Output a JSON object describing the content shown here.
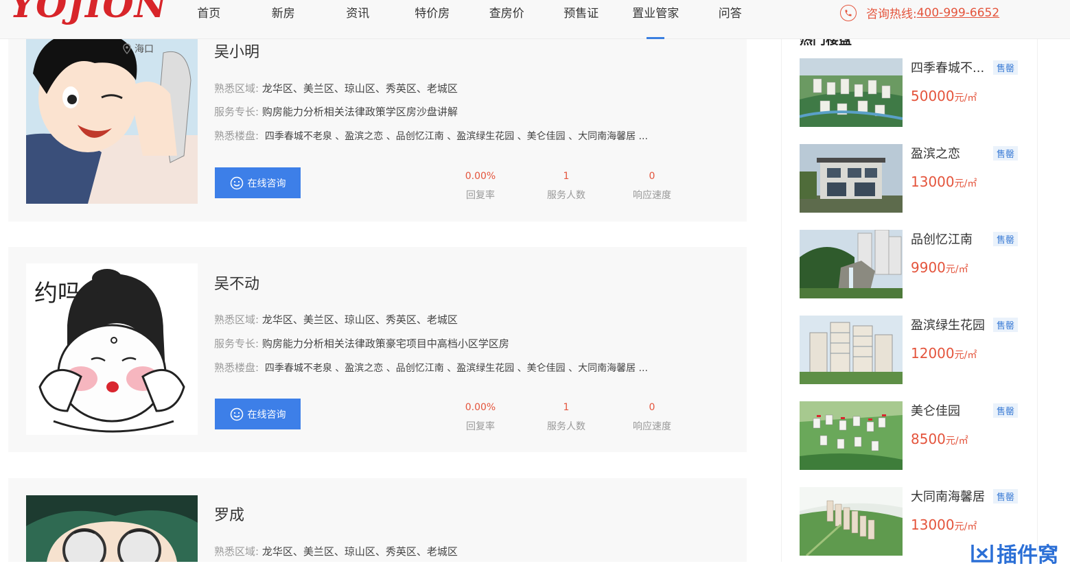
{
  "header": {
    "logo": "YOJION",
    "nav": [
      "首页",
      "新房",
      "资讯",
      "特价房",
      "查房价",
      "预售证",
      "置业管家",
      "问答"
    ],
    "active_nav_index": 6,
    "hotline_label": "咨询热线:",
    "hotline_number": "400-999-6652"
  },
  "agents": [
    {
      "name": "吴小明",
      "location": "海口",
      "areas_label": "熟悉区域:",
      "areas": "龙华区、美兰区、琼山区、秀英区、老城区",
      "specialty_label": "服务专长:",
      "specialty": "购房能力分析相关法律政策学区房沙盘讲解",
      "properties_label": "熟悉楼盘:",
      "properties": "四季春城不老泉 、盈滨之恋 、品创忆江南 、盈滨绿生花园 、美仑佳园 、大同南海馨居 ...",
      "consult_label": "在线咨询",
      "stats": [
        {
          "value": "0.00%",
          "label": "回复率"
        },
        {
          "value": "1",
          "label": "服务人数"
        },
        {
          "value": "0",
          "label": "响应速度"
        }
      ]
    },
    {
      "name": "吴不动",
      "areas_label": "熟悉区域:",
      "areas": "龙华区、美兰区、琼山区、秀英区、老城区",
      "specialty_label": "服务专长:",
      "specialty": "购房能力分析相关法律政策豪宅项目中高档小区学区房",
      "properties_label": "熟悉楼盘:",
      "properties": "四季春城不老泉 、盈滨之恋 、品创忆江南 、盈滨绿生花园 、美仑佳园 、大同南海馨居 ...",
      "consult_label": "在线咨询",
      "avatar_caption": "约吗~",
      "stats": [
        {
          "value": "0.00%",
          "label": "回复率"
        },
        {
          "value": "1",
          "label": "服务人数"
        },
        {
          "value": "0",
          "label": "响应速度"
        }
      ]
    },
    {
      "name": "罗成",
      "areas_label": "熟悉区域:",
      "areas": "龙华区、美兰区、琼山区、秀英区、老城区"
    }
  ],
  "sidebar": {
    "title": "热门楼盘",
    "items": [
      {
        "name": "四季春城不...",
        "badge": "售罄",
        "price": "50000",
        "unit": "元/㎡"
      },
      {
        "name": "盈滨之恋",
        "badge": "售罄",
        "price": "13000",
        "unit": "元/㎡"
      },
      {
        "name": "品创忆江南",
        "badge": "售罄",
        "price": "9900",
        "unit": "元/㎡"
      },
      {
        "name": "盈滨绿生花园",
        "badge": "售罄",
        "price": "12000",
        "unit": "元/㎡"
      },
      {
        "name": "美仑佳园",
        "badge": "售罄",
        "price": "8500",
        "unit": "元/㎡"
      },
      {
        "name": "大同南海馨居",
        "badge": "售罄",
        "price": "13000",
        "unit": "元/㎡"
      }
    ]
  },
  "watermark": "插件窝"
}
